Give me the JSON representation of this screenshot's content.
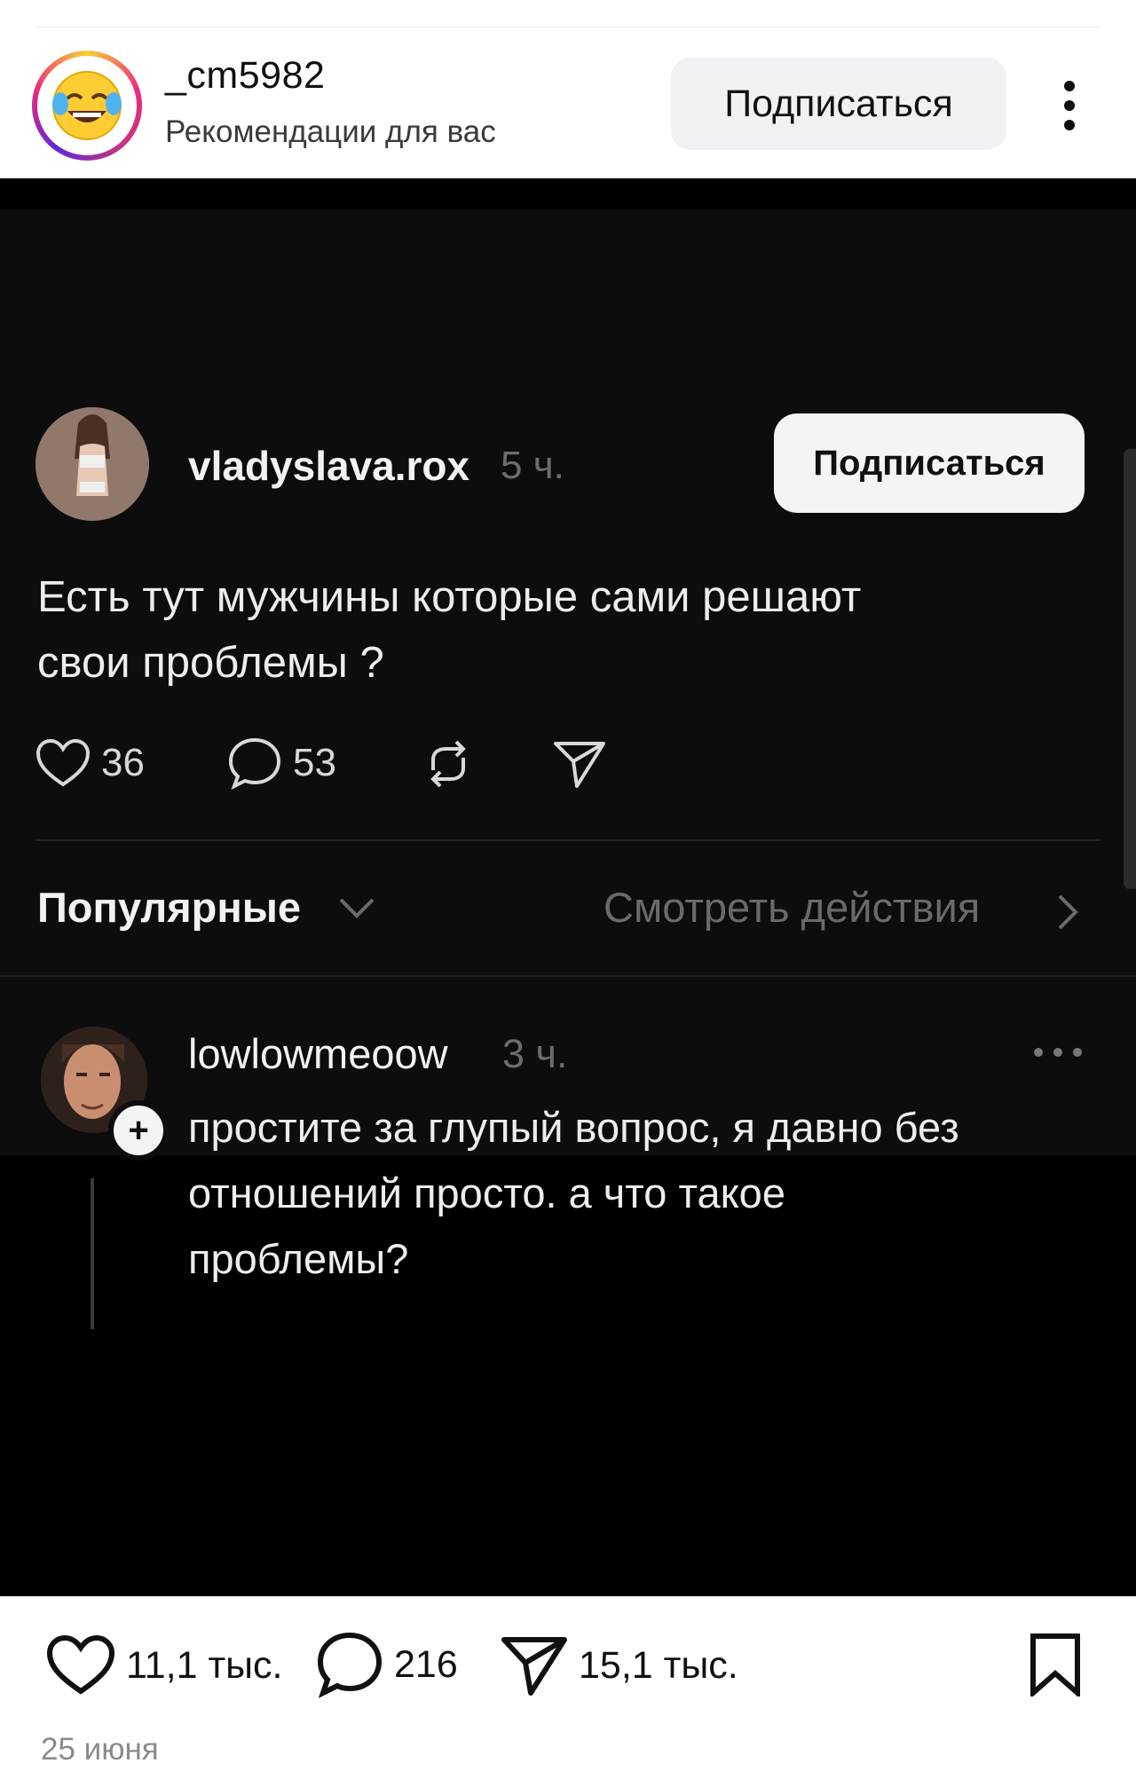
{
  "header": {
    "username": "_cm5982",
    "subtitle": "Рекомендации для вас",
    "follow_label": "Подписаться",
    "avatar_icon": "face-with-tears-of-joy-emoji-icon",
    "more_icon": "vertical-dots-icon"
  },
  "screenshot": {
    "post": {
      "username": "vladyslava.rox",
      "time": "5 ч.",
      "follow_label": "Подписаться",
      "text_line1": "Есть тут мужчины которые сами решают",
      "text_line2": "свои проблемы ?",
      "likes": "36",
      "comments": "53",
      "icons": [
        "heart-icon",
        "comment-icon",
        "repost-icon",
        "share-icon"
      ]
    },
    "sort": {
      "label": "Популярные",
      "view_activity": "Смотреть действия"
    },
    "comment": {
      "username": "lowlowmeoow",
      "time": "3 ч.",
      "text_line1": "простите за глупый вопрос, я давно без",
      "text_line2": "отношений просто. а что такое",
      "text_line3": "проблемы?",
      "follow_plus": "+"
    }
  },
  "actions": {
    "likes": "11,1 тыс.",
    "comments": "216",
    "shares": "15,1 тыс.",
    "icons": [
      "heart-icon",
      "comment-icon",
      "share-icon",
      "bookmark-icon"
    ]
  },
  "date": "25 июня",
  "colors": {
    "accent_gradient": [
      "#f9ce34",
      "#ee2a7b",
      "#6228d7"
    ],
    "dark_bg": "#0d0d0d",
    "follow_btn_bg": "#eff1f4"
  }
}
